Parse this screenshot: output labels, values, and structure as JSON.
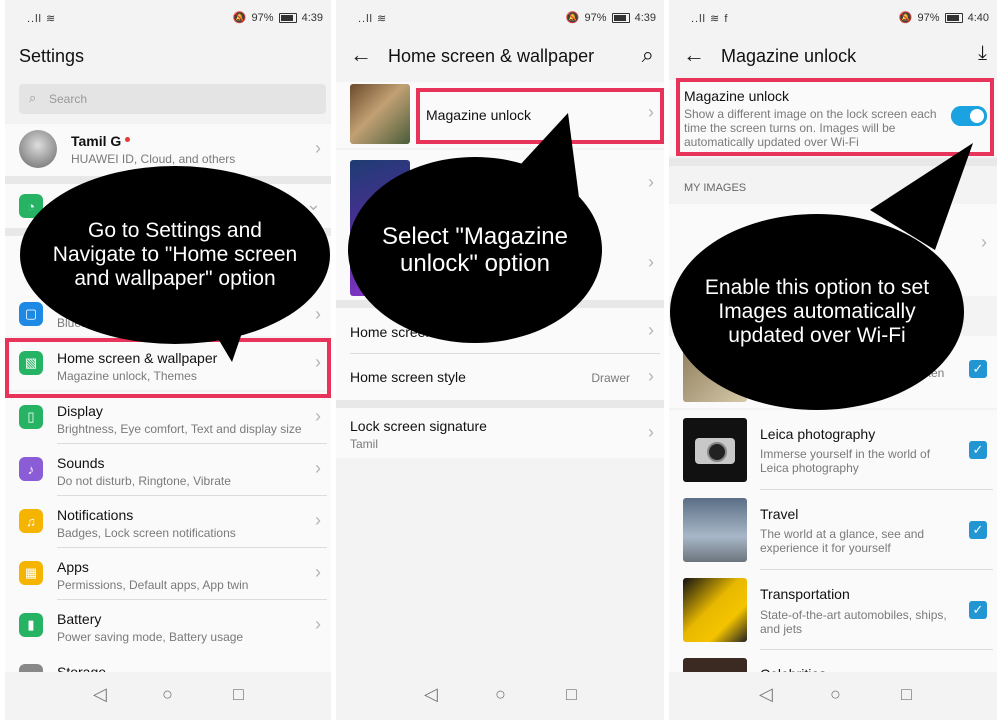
{
  "panel1": {
    "status": {
      "signal": "..ll ≋",
      "battery_pct": "97%",
      "time": "4:39"
    },
    "title": "Settings",
    "search_placeholder": "Search",
    "profile": {
      "name": "Tamil G",
      "sub": "HUAWEI ID, Cloud, and others"
    },
    "bluetooth_partial": "Bluetoo",
    "items": [
      {
        "title": "Home screen & wallpaper",
        "sub": "Magazine unlock, Themes",
        "icon": "home-wallpaper-icon",
        "color": "#27b364"
      },
      {
        "title": "Display",
        "sub": "Brightness, Eye comfort, Text and display size",
        "icon": "display-icon",
        "color": "#27b364"
      },
      {
        "title": "Sounds",
        "sub": "Do not disturb, Ringtone, Vibrate",
        "icon": "sound-icon",
        "color": "#8a5cd6"
      },
      {
        "title": "Notifications",
        "sub": "Badges, Lock screen notifications",
        "icon": "bell-icon",
        "color": "#f4b400"
      },
      {
        "title": "Apps",
        "sub": "Permissions, Default apps, App twin",
        "icon": "apps-icon",
        "color": "#f4b400"
      },
      {
        "title": "Battery",
        "sub": "Power saving mode, Battery usage",
        "icon": "battery-icon",
        "color": "#27b364"
      },
      {
        "title": "Storage",
        "sub": "",
        "icon": "storage-icon",
        "color": "#888888"
      }
    ],
    "callout": "Go to Settings and Navigate to \"Home screen and wallpaper\" option"
  },
  "panel2": {
    "status": {
      "signal": "..ll ≋",
      "battery_pct": "97%",
      "time": "4:39"
    },
    "title": "Home screen & wallpaper",
    "magazine": "Magazine unlock",
    "home_screen_partial": "Home screen",
    "home_style": {
      "title": "Home screen style",
      "value": "Drawer"
    },
    "lock_sig": {
      "title": "Lock screen signature",
      "sub": "Tamil"
    },
    "callout": "Select \"Magazine unlock\" option"
  },
  "panel3": {
    "status": {
      "signal": "..ll ≋ f",
      "battery_pct": "97%",
      "time": "4:40"
    },
    "title": "Magazine unlock",
    "toggle": {
      "title": "Magazine unlock",
      "desc": "Show a different image on the lock screen each time the screen turns on. Images will be automatically updated over Wi-Fi",
      "on": true
    },
    "my_images": "MY IMAGES",
    "partial_ken": "ken",
    "categories": [
      {
        "title": "Leica photography",
        "desc": "Immerse yourself in the world of Leica photography",
        "checked": true
      },
      {
        "title": "Travel",
        "desc": "The world at a glance, see and experience it for yourself",
        "checked": true
      },
      {
        "title": "Transportation",
        "desc": "State-of-the-art automobiles, ships, and jets",
        "checked": true
      },
      {
        "title": "Celebrities",
        "desc": "",
        "checked": true
      }
    ],
    "callout": "Enable this option to set Images automatically updated over Wi-Fi"
  },
  "nav": {
    "back": "◁",
    "home": "○",
    "recent": "□"
  },
  "colors": {
    "highlight": "#e8335a",
    "accent": "#1aa3e0",
    "callout_bg": "#000000"
  }
}
